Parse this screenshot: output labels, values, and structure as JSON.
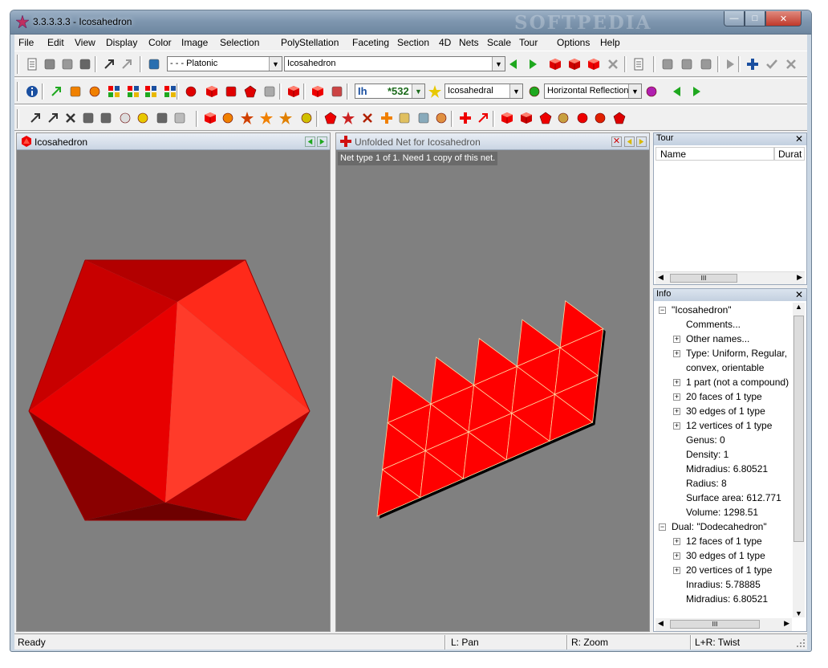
{
  "window": {
    "title": "3.3.3.3.3 - Icosahedron",
    "watermark": "SOFTPEDIA",
    "minimize": "—",
    "maximize": "□",
    "close": "✕"
  },
  "menu": [
    "File",
    "Edit",
    "View",
    "Display",
    "Color",
    "Image",
    "Selection",
    "Poly",
    "Stellation",
    "Faceting",
    "Section",
    "4D",
    "Nets",
    "Scale",
    "Tour",
    "Options",
    "Help"
  ],
  "toolbar1": {
    "category": "- - - Platonic",
    "polyhedron": "Icosahedron"
  },
  "toolbar2": {
    "symmetry": "Ih",
    "symmetry_count": "*532",
    "symmetry_type": "Icosahedral",
    "reflection": "Horizontal Reflection"
  },
  "left_panel": {
    "title": "Icosahedron"
  },
  "net_panel": {
    "title": "Unfolded Net for Icosahedron",
    "info": "Net type 1 of 1.  Need 1 copy of this net."
  },
  "tour_panel": {
    "title": "Tour",
    "columns": [
      "Name",
      "Durat"
    ],
    "scroll_grip": "III"
  },
  "info_panel": {
    "title": "Info",
    "tree": [
      {
        "label": "\"Icosahedron\"",
        "level": 0,
        "expander": "−"
      },
      {
        "label": "Comments...",
        "level": 1,
        "expander": ""
      },
      {
        "label": "Other names...",
        "level": 1,
        "expander": "+"
      },
      {
        "label": "Type: Uniform, Regular,",
        "level": 1,
        "expander": "+"
      },
      {
        "label": "convex, orientable",
        "level": 1,
        "expander": ""
      },
      {
        "label": "1 part (not a compound)",
        "level": 1,
        "expander": "+"
      },
      {
        "label": "20 faces of 1 type",
        "level": 1,
        "expander": "+"
      },
      {
        "label": "30 edges of 1 type",
        "level": 1,
        "expander": "+"
      },
      {
        "label": "12 vertices of 1 type",
        "level": 1,
        "expander": "+"
      },
      {
        "label": "Genus: 0",
        "level": 1,
        "expander": ""
      },
      {
        "label": "Density: 1",
        "level": 1,
        "expander": ""
      },
      {
        "label": "Midradius: 6.80521",
        "level": 1,
        "expander": ""
      },
      {
        "label": "Radius: 8",
        "level": 1,
        "expander": ""
      },
      {
        "label": "Surface area: 612.771",
        "level": 1,
        "expander": ""
      },
      {
        "label": "Volume: 1298.51",
        "level": 1,
        "expander": ""
      },
      {
        "label": "Dual: \"Dodecahedron\"",
        "level": 0,
        "expander": "−"
      },
      {
        "label": "12 faces of 1 type",
        "level": 1,
        "expander": "+"
      },
      {
        "label": "30 edges of 1 type",
        "level": 1,
        "expander": "+"
      },
      {
        "label": "20 vertices of 1 type",
        "level": 1,
        "expander": "+"
      },
      {
        "label": "Inradius: 5.78885",
        "level": 1,
        "expander": ""
      },
      {
        "label": "Midradius: 6.80521",
        "level": 1,
        "expander": ""
      }
    ]
  },
  "status": {
    "left": "Ready",
    "pan": "L: Pan",
    "zoom": "R: Zoom",
    "twist": "L+R: Twist"
  },
  "colors": {
    "face_light": "#ff3b30",
    "face_mid": "#e00000",
    "face_dark": "#a00000",
    "face_darker": "#6a0000",
    "viewport_bg": "#808080",
    "net_face": "#ff0000"
  },
  "icons": {
    "toolbar1": [
      "open-icon",
      "save-icon",
      "save-all-icon",
      "print-icon",
      "undo-icon",
      "redo-icon",
      "tour-icon",
      "prev-poly-icon",
      "next-poly-icon",
      "stellate-icon",
      "facet-icon",
      "compound-icon",
      "delete-icon",
      "list-view-icon",
      "import-icon",
      "export-icon",
      "disk-icon",
      "play-icon",
      "add-icon",
      "check-icon",
      "remove-icon"
    ],
    "toolbar2": [
      "info-icon",
      "wand-icon",
      "lock-icon",
      "rainbow-icon",
      "grid-a-icon",
      "grid-b-icon",
      "grid-c-icon",
      "grid-d-icon",
      "gear-icon",
      "cube-icon",
      "net-icon",
      "pentagon-icon",
      "ruler-icon",
      "box-icon",
      "unfold-icon",
      "split-icon",
      "crosshair-icon",
      "color-icon",
      "vertex-icon",
      "edge-icon",
      "face-icon"
    ],
    "toolbar3": [
      "pointer-icon",
      "query-icon",
      "scissors-icon",
      "measure-icon",
      "transform-icon",
      "dice-icon",
      "lemon-icon",
      "spring-icon",
      "model-icon",
      "poly-a-icon",
      "poly-b-icon",
      "poly-c-icon",
      "poly-d-icon",
      "poly-e-icon",
      "pentagon-small-icon",
      "star-icon",
      "cross-icon",
      "node-icon",
      "diamond-icon",
      "box-small-icon",
      "wheel-icon",
      "plus-red-icon",
      "arrow-icon",
      "gem-a-icon",
      "gem-b-icon",
      "gem-c-icon",
      "gem-d-icon",
      "gem-e-icon",
      "gem-f-icon",
      "gem-g-icon",
      "gem-h-icon"
    ]
  }
}
